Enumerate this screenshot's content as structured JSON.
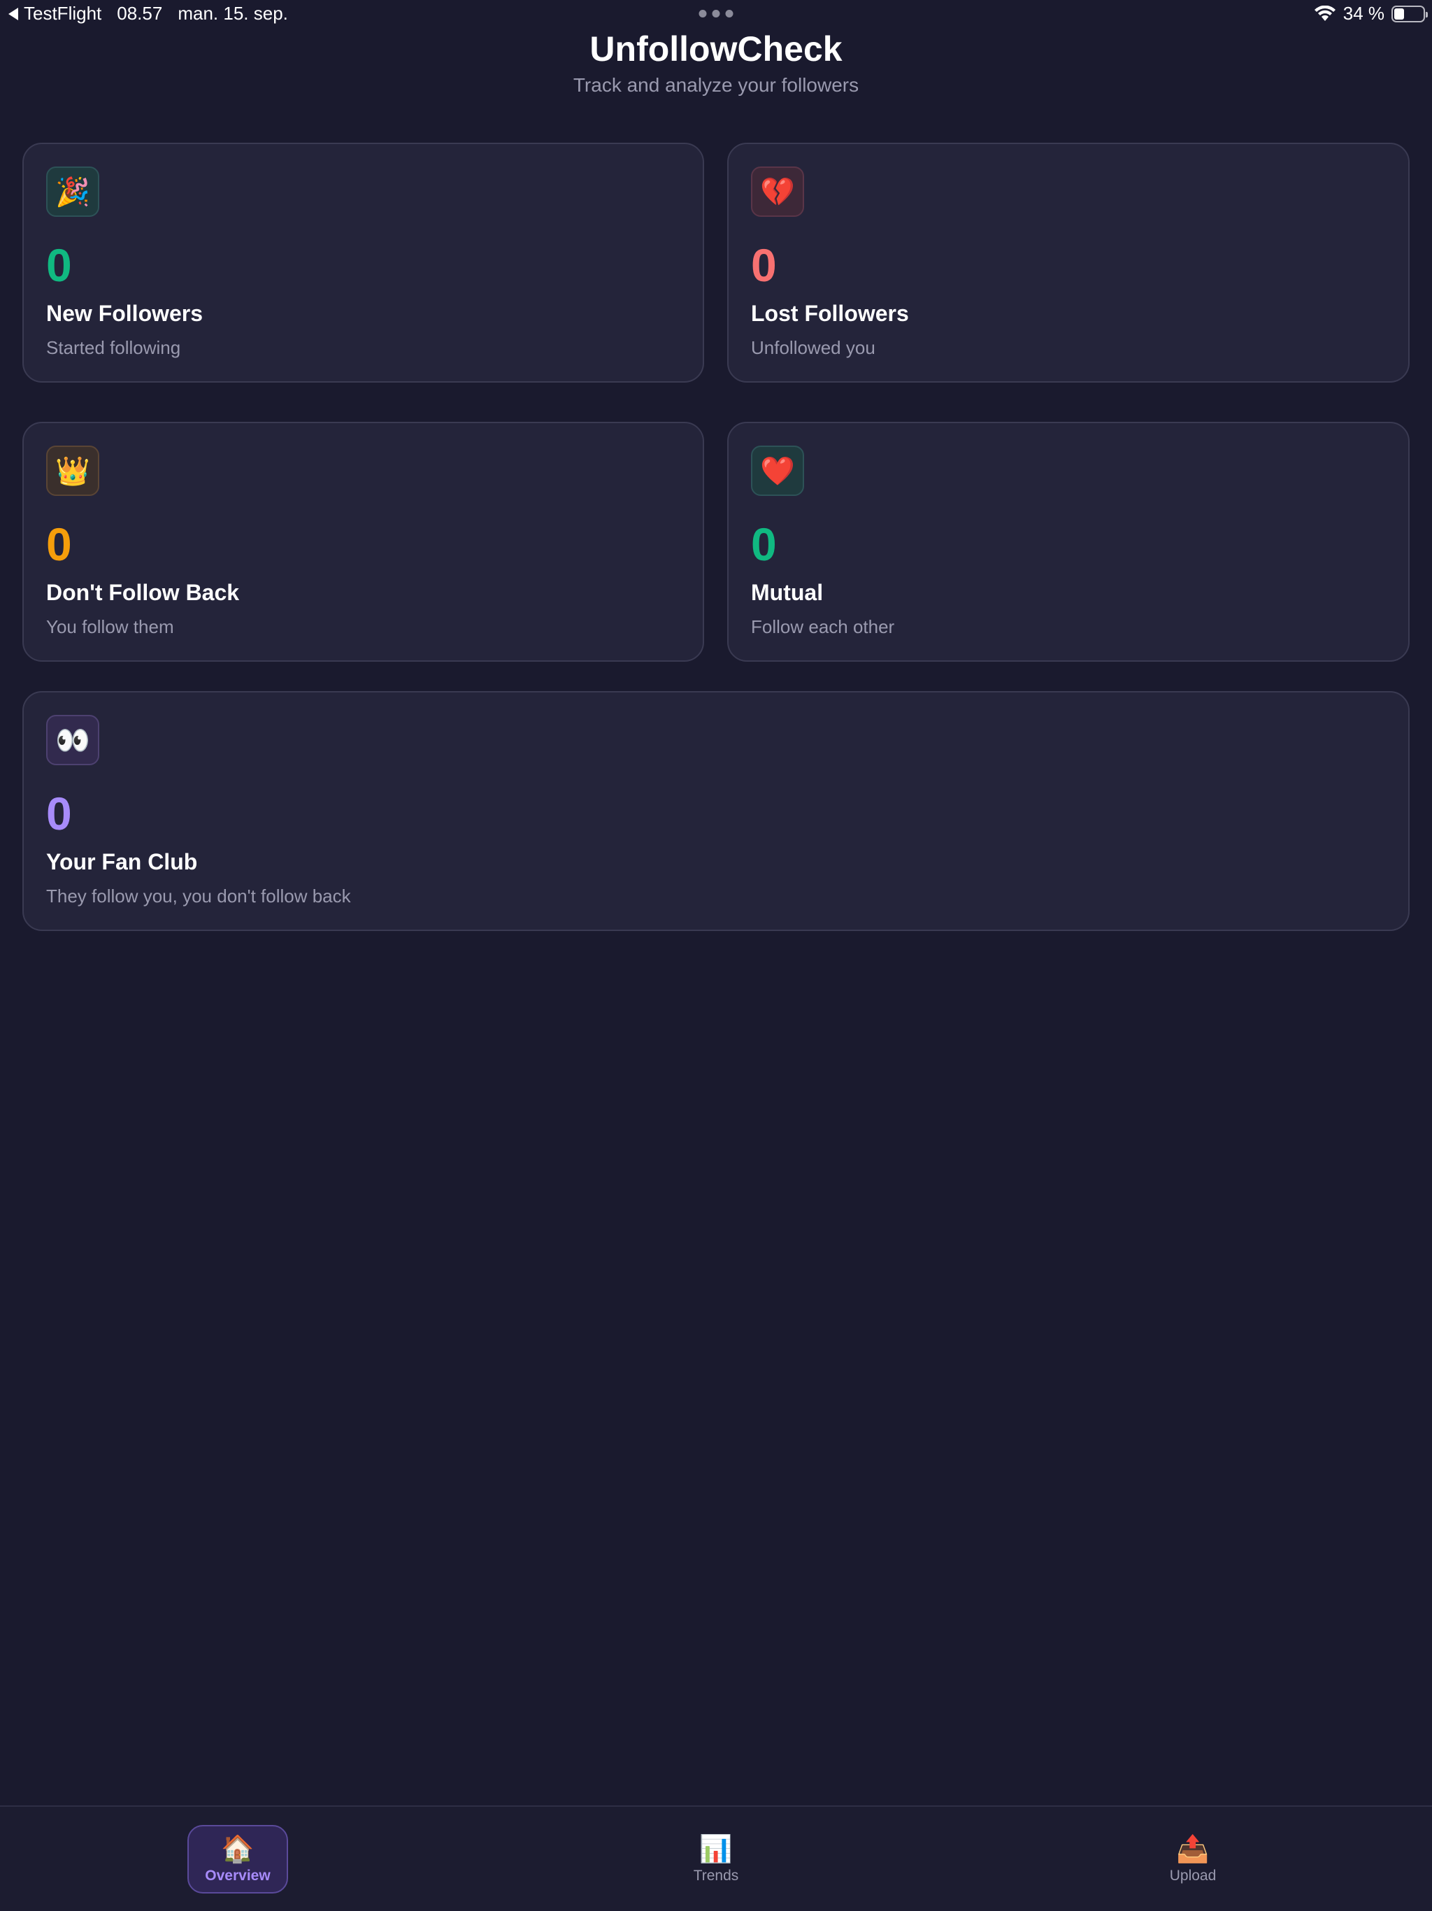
{
  "status_bar": {
    "back_app": "TestFlight",
    "time": "08.57",
    "date": "man. 15. sep.",
    "battery": "34 %",
    "battery_level": 0.34
  },
  "header": {
    "title": "UnfollowCheck",
    "subtitle": "Track and analyze your followers"
  },
  "cards": [
    {
      "icon": "🎉",
      "icon_name": "party-popper-icon",
      "value": "0",
      "label": "New Followers",
      "description": "Started following",
      "color": "#10b981"
    },
    {
      "icon": "💔",
      "icon_name": "broken-heart-icon",
      "value": "0",
      "label": "Lost Followers",
      "description": "Unfollowed you",
      "color": "#f87171"
    },
    {
      "icon": "👑",
      "icon_name": "crown-icon",
      "value": "0",
      "label": "Don't Follow Back",
      "description": "You follow them",
      "color": "#f59e0b"
    },
    {
      "icon": "❤️",
      "icon_name": "heart-icon",
      "value": "0",
      "label": "Mutual",
      "description": "Follow each other",
      "color": "#10b981"
    },
    {
      "icon": "👀",
      "icon_name": "eyes-icon",
      "value": "0",
      "label": "Your Fan Club",
      "description": "They follow you, you don't follow back",
      "color": "#a78bfa"
    }
  ],
  "tabs": [
    {
      "icon": "🏠",
      "icon_name": "house-icon",
      "label": "Overview",
      "active": true
    },
    {
      "icon": "📊",
      "icon_name": "bar-chart-icon",
      "label": "Trends",
      "active": false
    },
    {
      "icon": "📤",
      "icon_name": "outbox-tray-icon",
      "label": "Upload",
      "active": false
    }
  ],
  "colors": {
    "background": "#1a1a2e",
    "card": "#24243a",
    "accent": "#a78bfa"
  }
}
